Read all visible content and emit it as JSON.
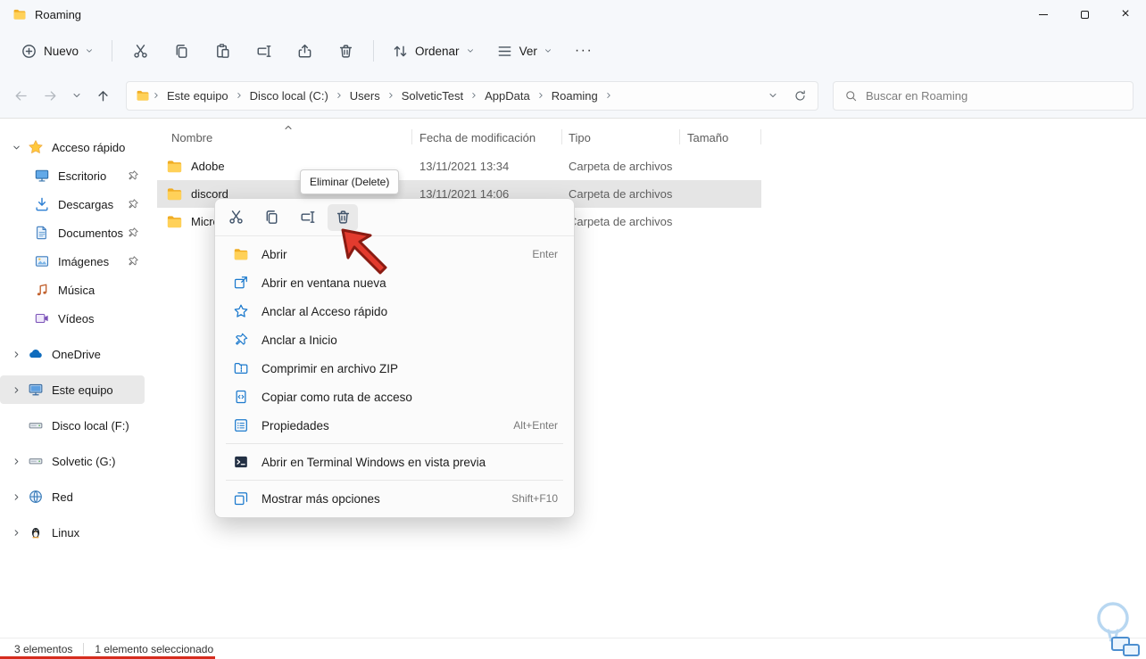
{
  "colors": {
    "accent_blue": "#1b79cd",
    "arrow_red": "#e33b2e",
    "folder_yellow": "#ffd159",
    "selection_gray": "#e5e5e5"
  },
  "window": {
    "title": "Roaming"
  },
  "toolbar": {
    "new": "Nuevo",
    "sort": "Ordenar",
    "view": "Ver",
    "more": "···"
  },
  "navbar": {
    "breadcrumb": [
      "Este equipo",
      "Disco local (C:)",
      "Users",
      "SolveticTest",
      "AppData",
      "Roaming"
    ],
    "search_placeholder": "Buscar en Roaming"
  },
  "sidebar": {
    "items": [
      {
        "label": "Acceso rápido"
      },
      {
        "label": "Escritorio",
        "pinned": true
      },
      {
        "label": "Descargas",
        "pinned": true
      },
      {
        "label": "Documentos",
        "pinned": true
      },
      {
        "label": "Imágenes",
        "pinned": true
      },
      {
        "label": "Música"
      },
      {
        "label": "Vídeos"
      },
      {
        "label": "OneDrive"
      },
      {
        "label": "Este equipo",
        "selected": true
      },
      {
        "label": "Disco local (F:)"
      },
      {
        "label": "Solvetic (G:)"
      },
      {
        "label": "Red"
      },
      {
        "label": "Linux"
      }
    ]
  },
  "filelist": {
    "columns": [
      "Nombre",
      "Fecha de modificación",
      "Tipo",
      "Tamaño"
    ],
    "rows": [
      {
        "name": "Adobe",
        "modified": "13/11/2021 13:34",
        "type": "Carpeta de archivos",
        "size": ""
      },
      {
        "name": "discord",
        "modified": "13/11/2021 14:06",
        "type": "Carpeta de archivos",
        "size": "",
        "selected": true
      },
      {
        "name": "Microsoft",
        "modified": "",
        "type": "Carpeta de archivos",
        "size": ""
      }
    ]
  },
  "context_menu": {
    "tooltip": "Eliminar (Delete)",
    "items": [
      {
        "label": "Abrir",
        "shortcut": "Enter"
      },
      {
        "label": "Abrir en ventana nueva",
        "shortcut": ""
      },
      {
        "label": "Anclar al Acceso rápido",
        "shortcut": ""
      },
      {
        "label": "Anclar a Inicio",
        "shortcut": ""
      },
      {
        "label": "Comprimir en archivo ZIP",
        "shortcut": ""
      },
      {
        "label": "Copiar como ruta de acceso",
        "shortcut": ""
      },
      {
        "label": "Propiedades",
        "shortcut": "Alt+Enter"
      },
      {
        "label": "Abrir en Terminal Windows en vista previa",
        "shortcut": ""
      },
      {
        "label": "Mostrar más opciones",
        "shortcut": "Shift+F10"
      }
    ]
  },
  "statusbar": {
    "items_count": "3 elementos",
    "selected_count": "1 elemento seleccionado"
  }
}
